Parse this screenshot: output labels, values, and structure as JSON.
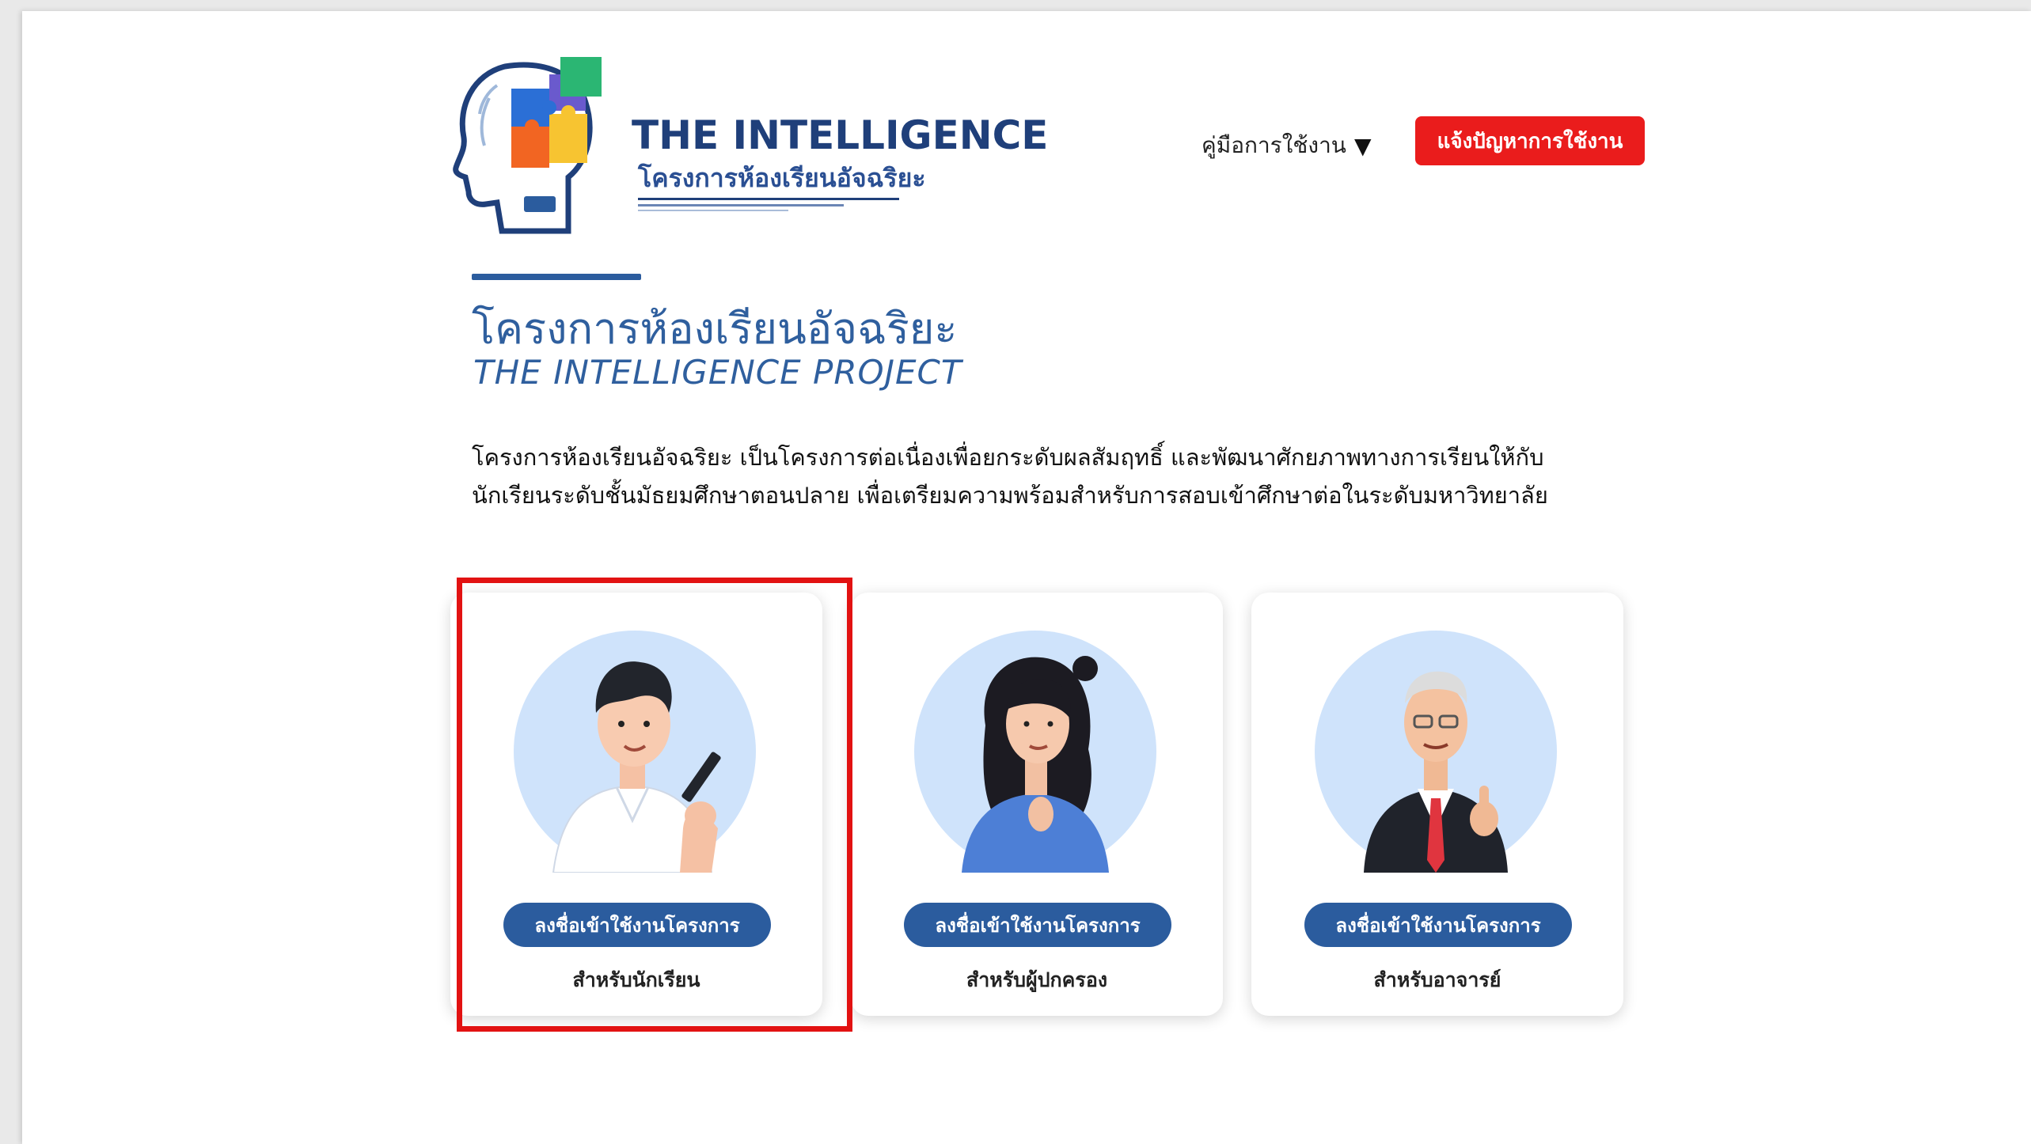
{
  "header": {
    "logo_title": "THE INTELLIGENCE",
    "logo_subtitle": "โครงการห้องเรียนอัจฉริยะ",
    "manual_label": "คู่มือการใช้งาน",
    "manual_caret": "▼",
    "report_button": "แจ้งปัญหาการใช้งาน"
  },
  "intro": {
    "title_th": "โครงการห้องเรียนอัจฉริยะ",
    "title_en": "THE INTELLIGENCE PROJECT",
    "description_line1": "โครงการห้องเรียนอัจฉริยะ เป็นโครงการต่อเนื่องเพื่อยกระดับผลสัมฤทธิ์ และพัฒนาศักยภาพทางการเรียนให้กับ",
    "description_line2": "นักเรียนระดับชั้นมัธยมศึกษาตอนปลาย   เพื่อเตรียมความพร้อมสำหรับการสอบเข้าศึกษาต่อในระดับมหาวิทยาลัย"
  },
  "cards": [
    {
      "button": "ลงชื่อเข้าใช้งานโครงการ",
      "role": "สำหรับนักเรียน",
      "selected": true
    },
    {
      "button": "ลงชื่อเข้าใช้งานโครงการ",
      "role": "สำหรับผู้ปกครอง",
      "selected": false
    },
    {
      "button": "ลงชื่อเข้าใช้งานโครงการ",
      "role": "สำหรับอาจารย์",
      "selected": false
    }
  ],
  "colors": {
    "brand_blue": "#2b5c9e",
    "report_red": "#ea1c1c",
    "highlight_red": "#e21212",
    "avatar_bg": "#cfe3fb"
  }
}
